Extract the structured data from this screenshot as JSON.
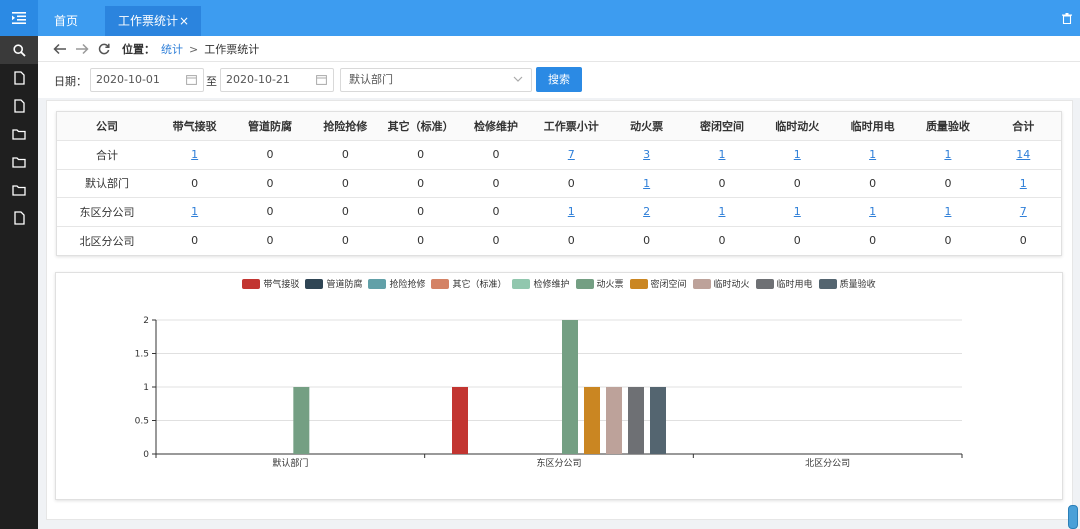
{
  "tabs": {
    "home": "首页",
    "active": "工作票统计",
    "close": "×"
  },
  "breadcrumb": {
    "label": "位置：",
    "link": "统计",
    "sep": ">",
    "current": "工作票统计"
  },
  "filter": {
    "date_label": "日期：",
    "start": "2020-10-01",
    "to": "至",
    "end": "2020-10-21",
    "dept": "默认部门",
    "search": "搜索"
  },
  "table": {
    "headers": [
      "公司",
      "带气接驳",
      "管道防腐",
      "抢险抢修",
      "其它（标准）",
      "检修维护",
      "工作票小计",
      "动火票",
      "密闭空间",
      "临时动火",
      "临时用电",
      "质量验收",
      "合计"
    ],
    "rows": [
      [
        "合计",
        "1",
        "0",
        "0",
        "0",
        "0",
        "7",
        "3",
        "1",
        "1",
        "1",
        "1",
        "14"
      ],
      [
        "默认部门",
        "0",
        "0",
        "0",
        "0",
        "0",
        "0",
        "1",
        "0",
        "0",
        "0",
        "0",
        "1"
      ],
      [
        "东区分公司",
        "1",
        "0",
        "0",
        "0",
        "0",
        "1",
        "2",
        "1",
        "1",
        "1",
        "1",
        "7"
      ],
      [
        "北区分公司",
        "0",
        "0",
        "0",
        "0",
        "0",
        "0",
        "0",
        "0",
        "0",
        "0",
        "0",
        "0"
      ]
    ],
    "link_cells": [
      [
        0,
        1
      ],
      [
        0,
        6
      ],
      [
        0,
        7
      ],
      [
        0,
        8
      ],
      [
        0,
        9
      ],
      [
        0,
        10
      ],
      [
        0,
        11
      ],
      [
        0,
        12
      ],
      [
        1,
        7
      ],
      [
        1,
        12
      ],
      [
        2,
        1
      ],
      [
        2,
        6
      ],
      [
        2,
        7
      ],
      [
        2,
        8
      ],
      [
        2,
        9
      ],
      [
        2,
        10
      ],
      [
        2,
        11
      ],
      [
        2,
        12
      ]
    ]
  },
  "chart_data": {
    "type": "bar",
    "categories": [
      "默认部门",
      "东区分公司",
      "北区分公司"
    ],
    "ylim": [
      0,
      2
    ],
    "yticks": [
      "0",
      "0.5",
      "1",
      "1.5",
      "2"
    ],
    "series": [
      {
        "name": "带气接驳",
        "color": "#c23531",
        "values": [
          0,
          1,
          0
        ]
      },
      {
        "name": "管道防腐",
        "color": "#2f4554",
        "values": [
          0,
          0,
          0
        ]
      },
      {
        "name": "抢险抢修",
        "color": "#61a0a8",
        "values": [
          0,
          0,
          0
        ]
      },
      {
        "name": "其它（标准）",
        "color": "#d48265",
        "values": [
          0,
          0,
          0
        ]
      },
      {
        "name": "检修维护",
        "color": "#91c7ae",
        "values": [
          0,
          0,
          0
        ]
      },
      {
        "name": "动火票",
        "color": "#749f83",
        "values": [
          1,
          2,
          0
        ]
      },
      {
        "name": "密闭空间",
        "color": "#ca8622",
        "values": [
          0,
          1,
          0
        ]
      },
      {
        "name": "临时动火",
        "color": "#bda29a",
        "values": [
          0,
          1,
          0
        ]
      },
      {
        "name": "临时用电",
        "color": "#6e7074",
        "values": [
          0,
          1,
          0
        ]
      },
      {
        "name": "质量验收",
        "color": "#546570",
        "values": [
          0,
          1,
          0
        ]
      }
    ]
  }
}
